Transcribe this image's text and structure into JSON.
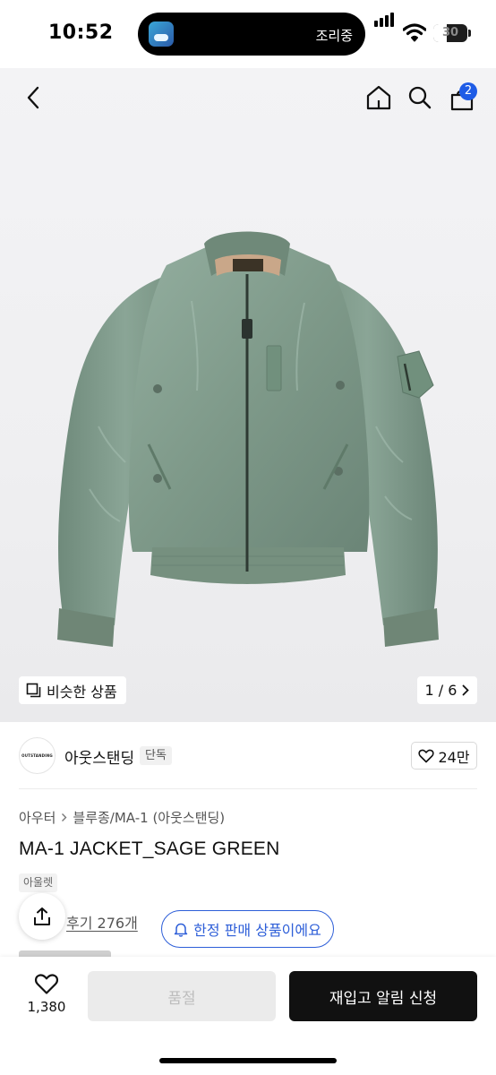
{
  "status_bar": {
    "time": "10:52",
    "live_activity": "조리중",
    "battery": "30"
  },
  "nav": {
    "back_icon": "chevron-left-icon",
    "home_icon": "home-icon",
    "search_icon": "search-icon",
    "cart_icon": "shopping-bag-icon",
    "cart_count": "2"
  },
  "gallery": {
    "similar_label": "비슷한 상품",
    "page_indicator": "1 / 6",
    "product_color": "#7e9989"
  },
  "brand": {
    "logo_text": "OUTSTANDING",
    "name": "아웃스탠딩",
    "badge": "단독",
    "likes": "24만"
  },
  "product": {
    "category_parent": "아우터",
    "category_path": "블루종/MA-1 (아웃스탠딩)",
    "title": "MA-1 JACKET_SAGE GREEN",
    "tag": "아울렛",
    "reviews": "후기 276개",
    "limited_label": "한정 판매 상품이에요"
  },
  "bottom_bar": {
    "wishlist_count": "1,380",
    "soldout_label": "품절",
    "restock_label": "재입고 알림 신청"
  },
  "colors": {
    "accent_blue": "#2d5ed8",
    "badge_blue": "#1e5ce6",
    "primary_button": "#111111"
  }
}
